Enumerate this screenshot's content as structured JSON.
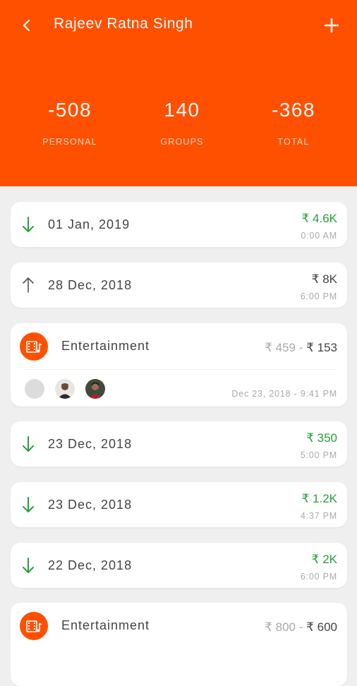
{
  "header": {
    "title": "Rajeev Ratna Singh",
    "back_icon": "chevron-left-icon",
    "add_icon": "plus-icon",
    "bg_color": "#ff5000"
  },
  "stats": [
    {
      "value": "-508",
      "label": "PERSONAL"
    },
    {
      "value": "140",
      "label": "GROUPS"
    },
    {
      "value": "-368",
      "label": "TOTAL"
    }
  ],
  "colors": {
    "accent": "#ff5000",
    "received": "#27a03a",
    "text": "#444444",
    "muted": "#aaaaaa"
  },
  "transactions": [
    {
      "type": "txn",
      "direction": "down",
      "date": "01 Jan, 2019",
      "amount": "₹ 4.6K",
      "time": "0:00 AM",
      "green": true
    },
    {
      "type": "txn",
      "direction": "up",
      "date": "28 Dec, 2018",
      "amount": "₹ 8K",
      "time": "6:00 PM",
      "green": false
    },
    {
      "type": "group",
      "name": "Entertainment",
      "amount_old": "₹ 459",
      "separator": " - ",
      "amount_new": "₹ 153",
      "datetime": "Dec 23, 2018 - 9:41 PM",
      "icon": "movie-music-icon"
    },
    {
      "type": "txn",
      "direction": "down",
      "date": "23 Dec, 2018",
      "amount": "₹ 350",
      "time": "5:00 PM",
      "green": true
    },
    {
      "type": "txn",
      "direction": "down",
      "date": "23 Dec, 2018",
      "amount": "₹ 1.2K",
      "time": "4:37 PM",
      "green": true
    },
    {
      "type": "txn",
      "direction": "down",
      "date": "22 Dec, 2018",
      "amount": "₹ 2K",
      "time": "6:00 PM",
      "green": true
    },
    {
      "type": "group",
      "name": "Entertainment",
      "amount_old": "₹ 800",
      "separator": " - ",
      "amount_new": "₹ 600",
      "icon": "movie-music-icon"
    }
  ]
}
